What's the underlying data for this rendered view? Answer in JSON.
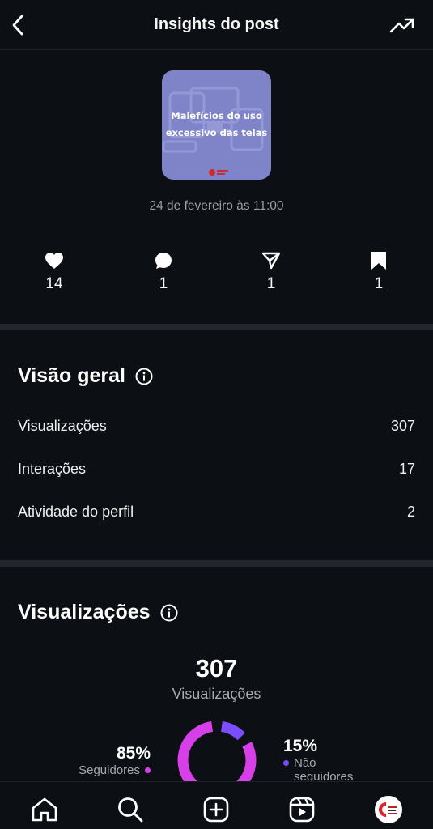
{
  "header": {
    "title": "Insights do post"
  },
  "post": {
    "thumbnail_text_line1": "Malefícios do uso",
    "thumbnail_text_line2": "excessivo das telas",
    "date": "24 de fevereiro às 11:00"
  },
  "stats": {
    "likes": "14",
    "comments": "1",
    "shares": "1",
    "saves": "1"
  },
  "overview": {
    "title": "Visão geral",
    "rows": [
      {
        "label": "Visualizações",
        "value": "307"
      },
      {
        "label": "Interações",
        "value": "17"
      },
      {
        "label": "Atividade do perfil",
        "value": "2"
      }
    ]
  },
  "views": {
    "title": "Visualizações",
    "total": "307",
    "total_label": "Visualizações",
    "followers_pct": "85%",
    "followers_label": "Seguidores",
    "nonfollowers_pct": "15%",
    "nonfollowers_label_1": "Não",
    "nonfollowers_label_2": "seguidores",
    "followers_fraction": 0.85,
    "colors": {
      "followers": "#d73fe8",
      "nonfollowers": "#7c4dff"
    }
  },
  "nav": [
    "home-icon",
    "search-icon",
    "create-icon",
    "reels-icon",
    "profile-avatar"
  ]
}
